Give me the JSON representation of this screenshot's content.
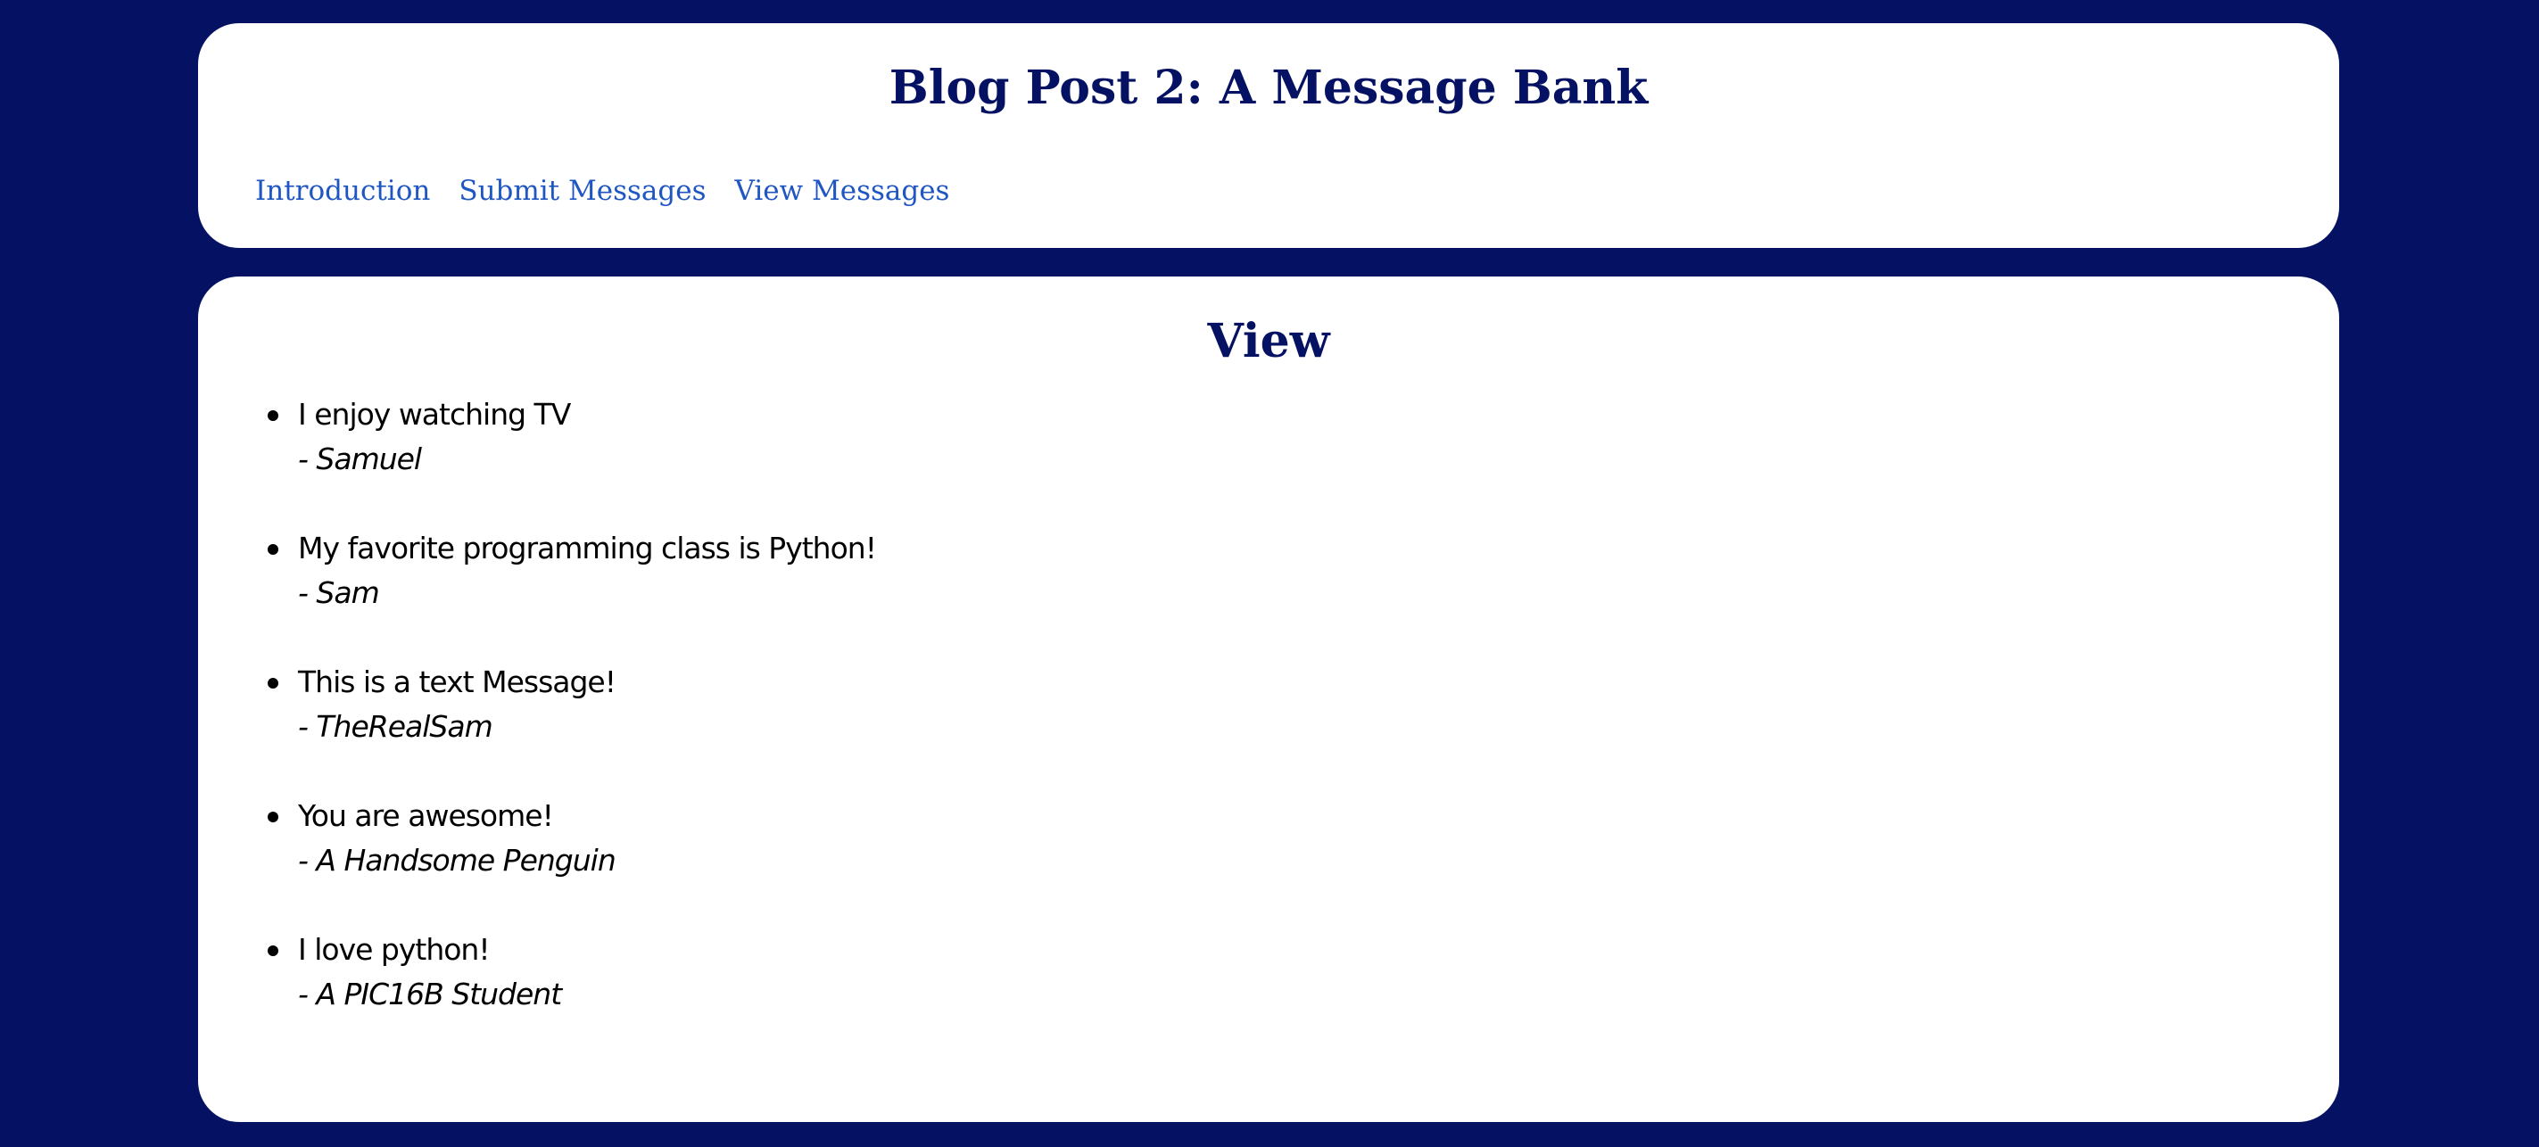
{
  "header": {
    "title": "Blog Post 2: A Message Bank",
    "nav": [
      {
        "label": "Introduction"
      },
      {
        "label": "Submit Messages"
      },
      {
        "label": "View Messages"
      }
    ]
  },
  "main": {
    "heading": "View",
    "messages": [
      {
        "text": "I enjoy watching TV",
        "author": "- Samuel"
      },
      {
        "text": "My favorite programming class is Python!",
        "author": "- Sam"
      },
      {
        "text": "This is a text Message!",
        "author": "- TheRealSam"
      },
      {
        "text": "You are awesome!",
        "author": "- A Handsome Penguin"
      },
      {
        "text": "I love python!",
        "author": "- A PIC16B Student"
      }
    ]
  },
  "colors": {
    "page_background": "#051162",
    "card_background": "#ffffff",
    "heading": "#051162",
    "link": "#1f56c2",
    "body_text": "#000000"
  }
}
